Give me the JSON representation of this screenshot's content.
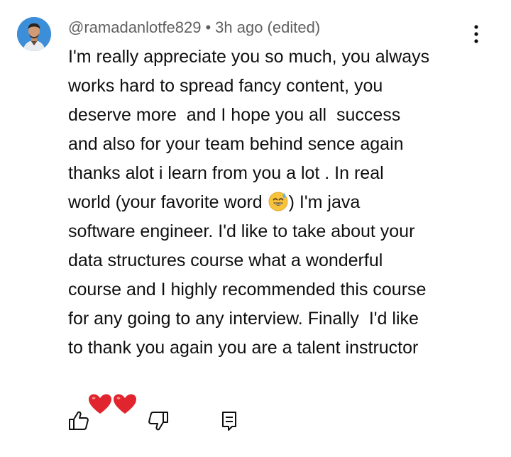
{
  "comment": {
    "author": "@ramadanlotfe829",
    "separator": "•",
    "time": "3h ago (edited)",
    "lines": [
      "I'm really appreciate you so much, you always",
      "works hard to spread fancy content, you",
      "deserve more  and I hope you all  success",
      "and also for your team behind sence again",
      "thanks alot i learn from you a lot . In real",
      "world (your favorite word ",
      "software engineer. I'd like to take about your",
      "data structures course what a wonderful",
      "course and I highly recommended this course",
      "for any going to any interview. Finally  I'd like",
      "to thank you again you are a talent instructor"
    ],
    "line6_after_emoji": ") I'm java"
  },
  "icons": {
    "avatar": "user-avatar",
    "menu": "vertical-dots-icon",
    "emoji": "grinning-sweat-emoji",
    "hearts": "red-heart-emoji",
    "like": "thumbs-up-icon",
    "dislike": "thumbs-down-icon",
    "reply": "reply-comment-icon"
  },
  "colors": {
    "background": "#ffffff",
    "text": "#0f0f0f",
    "meta": "#606060",
    "avatar_bg": "#3d8ed8",
    "heart": "#e0252e"
  }
}
